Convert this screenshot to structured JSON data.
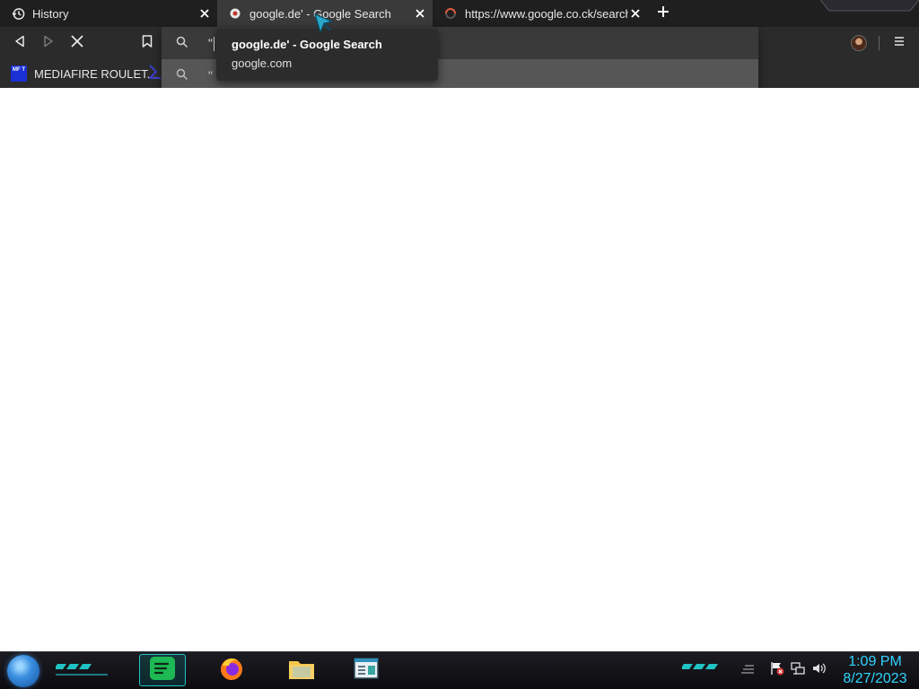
{
  "tabs": [
    {
      "title": "History",
      "icon": "history-icon"
    },
    {
      "title": "google.de' - Google Search",
      "icon": "google-favicon"
    },
    {
      "title": "https://www.google.co.ck/search?q",
      "icon": "loading-favicon"
    }
  ],
  "new_tab_icon": "plus-icon",
  "toolbar": {
    "back_icon": "back-arrow-icon",
    "forward_icon": "forward-arrow-icon",
    "stop_icon": "stop-loading-icon",
    "bookmark_icon": "bookmark-icon",
    "menu_icon": "hamburger-menu-icon"
  },
  "omnibox": {
    "typed_text": "\"",
    "suggestion_text": "\""
  },
  "bookmarks": [
    {
      "label": "MEDIAFIRE ROULET...",
      "icon_text": "MF T"
    }
  ],
  "tooltip": {
    "title": "google.de' - Google Search",
    "url": "google.com"
  },
  "taskbar": {
    "apps": [
      "spotify",
      "firefox",
      "file-explorer",
      "notepad"
    ],
    "time": "1:09 PM",
    "date": "8/27/2023"
  },
  "colors": {
    "tab_bar": "#1f1f1f",
    "active_tab": "#3a3a3a",
    "toolbar": "#2b2b2b",
    "clock": "#31d4ff",
    "taskbar_accent": "#1fc3c3"
  }
}
